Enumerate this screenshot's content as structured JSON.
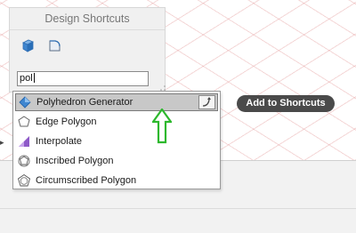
{
  "panel": {
    "title": "Design Shortcuts",
    "icons": [
      "solid-cube-icon",
      "surface-patch-icon"
    ]
  },
  "search": {
    "value": "pol"
  },
  "dropdown": {
    "items": [
      {
        "label": "Polyhedron Generator",
        "icon": "polyhedron-icon",
        "selected": true
      },
      {
        "label": "Edge Polygon",
        "icon": "edge-polygon-icon"
      },
      {
        "label": "Interpolate",
        "icon": "interpolate-icon"
      },
      {
        "label": "Inscribed Polygon",
        "icon": "inscribed-polygon-icon"
      },
      {
        "label": "Circumscribed Polygon",
        "icon": "circumscribed-polygon-icon"
      }
    ],
    "pin_icon": "pin-to-shortcuts-icon"
  },
  "add_to_shortcuts": {
    "label": "Add to Shortcuts"
  },
  "annotation": {
    "icon": "green-up-arrow-icon",
    "color": "#2db82d"
  }
}
